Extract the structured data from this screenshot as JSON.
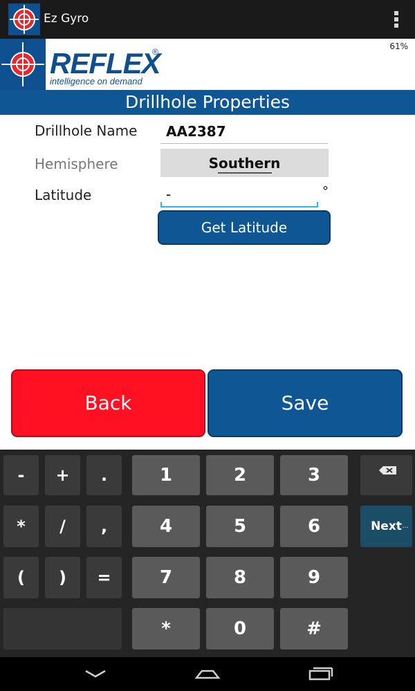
{
  "app": {
    "title": "Ez Gyro",
    "brand_color": "#0e5694"
  },
  "logo": {
    "name": "REFLEX",
    "registered": "®",
    "tagline": "intelligence on demand"
  },
  "status": {
    "battery": "61%"
  },
  "screen": {
    "title": "Drillhole Properties"
  },
  "form": {
    "drillhole_label": "Drillhole Name",
    "drillhole_value": "AA2387",
    "hemisphere_label": "Hemisphere",
    "hemisphere_value": "Southern",
    "latitude_label": "Latitude",
    "latitude_value": "-",
    "latitude_unit": "°",
    "get_latitude": "Get Latitude"
  },
  "actions": {
    "back": "Back",
    "save": "Save",
    "back_color": "#ff0f22",
    "save_color": "#0e5694"
  },
  "keyboard": {
    "row1": [
      "-",
      "+",
      ".",
      "1",
      "2",
      "3"
    ],
    "row2": [
      "*",
      "/",
      ",",
      "4",
      "5",
      "6"
    ],
    "row3": [
      "(",
      ")",
      "=",
      "7",
      "8",
      "9"
    ],
    "row4": [
      "*",
      "0",
      "#"
    ],
    "next": "Next",
    "next_dots": "..."
  },
  "icons": {
    "app": "reflex-crosshair-icon",
    "overflow": "overflow-menu-icon",
    "backspace": "backspace-icon",
    "nav_back": "back-chevron-icon",
    "nav_home": "home-icon",
    "nav_recents": "recents-icon"
  }
}
